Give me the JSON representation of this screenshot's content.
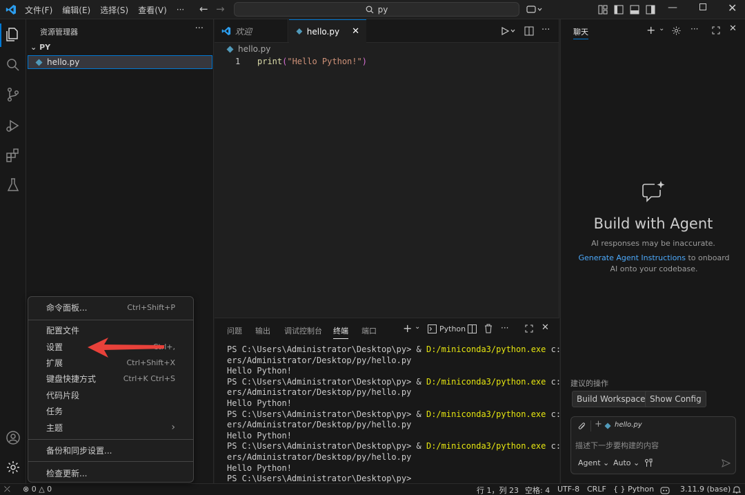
{
  "titlebar": {
    "menus": [
      "文件(F)",
      "编辑(E)",
      "选择(S)",
      "查看(V)",
      "···"
    ],
    "search_text": "py"
  },
  "sidebar": {
    "title": "资源管理器",
    "folder": "PY",
    "file": "hello.py"
  },
  "editor": {
    "tabs": [
      {
        "label": "欢迎"
      },
      {
        "label": "hello.py"
      }
    ],
    "breadcrumb": "hello.py",
    "line_number": "1",
    "code_fn": "print",
    "code_open": "(",
    "code_str": "\"Hello Python!\"",
    "code_close": ")"
  },
  "panel": {
    "tabs": [
      "问题",
      "输出",
      "调试控制台",
      "终端",
      "端口"
    ],
    "profile": "Python",
    "terminal_lines": [
      {
        "a": "PS C:\\Users\\Administrator\\Desktop\\py> & ",
        "b": "D:/miniconda3/python.exe",
        "c": " c:/Us"
      },
      {
        "a": "ers/Administrator/Desktop/py/hello.py",
        "b": "",
        "c": ""
      },
      {
        "a": "Hello Python!",
        "b": "",
        "c": ""
      },
      {
        "a": "PS C:\\Users\\Administrator\\Desktop\\py> & ",
        "b": "D:/miniconda3/python.exe",
        "c": " c:/Us"
      },
      {
        "a": "ers/Administrator/Desktop/py/hello.py",
        "b": "",
        "c": ""
      },
      {
        "a": "Hello Python!",
        "b": "",
        "c": ""
      },
      {
        "a": "PS C:\\Users\\Administrator\\Desktop\\py> & ",
        "b": "D:/miniconda3/python.exe",
        "c": " c:/Us"
      },
      {
        "a": "ers/Administrator/Desktop/py/hello.py",
        "b": "",
        "c": ""
      },
      {
        "a": "Hello Python!",
        "b": "",
        "c": ""
      },
      {
        "a": "PS C:\\Users\\Administrator\\Desktop\\py> & ",
        "b": "D:/miniconda3/python.exe",
        "c": " c:/Us"
      },
      {
        "a": "ers/Administrator/Desktop/py/hello.py",
        "b": "",
        "c": ""
      },
      {
        "a": "Hello Python!",
        "b": "",
        "c": ""
      },
      {
        "a": "PS C:\\Users\\Administrator\\Desktop\\py>",
        "b": "",
        "c": ""
      }
    ]
  },
  "chat": {
    "tab": "聊天",
    "title": "Build with Agent",
    "subtitle": "AI responses may be inaccurate.",
    "link": "Generate Agent Instructions",
    "hint_rest": " to onboard AI onto your codebase.",
    "suggest_title": "建议的操作",
    "chip1": "Build Workspace",
    "chip2": "Show Config",
    "context_file": "hello.py",
    "placeholder": "描述下一步要构建的内容",
    "mode": "Agent",
    "model": "Auto"
  },
  "manage_menu": {
    "items": [
      {
        "label": "命令面板...",
        "kb": "Ctrl+Shift+P"
      },
      {
        "label": "配置文件",
        "kb": ""
      },
      {
        "label": "设置",
        "kb": "Ctrl+,"
      },
      {
        "label": "扩展",
        "kb": "Ctrl+Shift+X"
      },
      {
        "label": "键盘快捷方式",
        "kb": "Ctrl+K Ctrl+S"
      },
      {
        "label": "代码片段",
        "kb": ""
      },
      {
        "label": "任务",
        "kb": ""
      },
      {
        "label": "主题",
        "kb": "›"
      },
      {
        "label": "备份和同步设置...",
        "kb": ""
      },
      {
        "label": "检查更新...",
        "kb": ""
      }
    ]
  },
  "statusbar": {
    "errors": "0",
    "warnings": "0",
    "position": "行 1，列 23",
    "spaces": "空格: 4",
    "encoding": "UTF-8",
    "eol": "CRLF",
    "language": "Python",
    "interpreter": "3.11.9 (base)"
  },
  "colors": {
    "accent": "#0078d4",
    "link": "#4daafc",
    "terminal_yellow": "#e5e510",
    "arrow": "#e8413a"
  }
}
